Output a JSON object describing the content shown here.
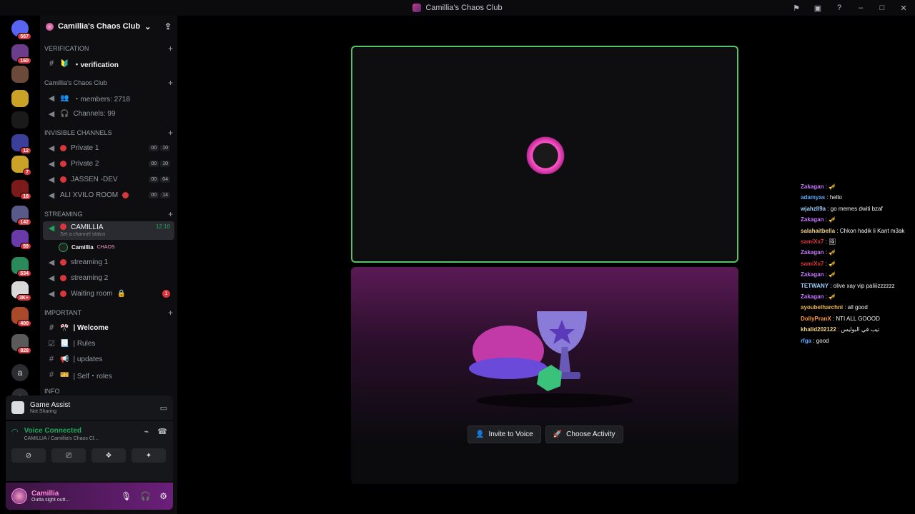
{
  "window": {
    "title": "Camillia's Chaos Club"
  },
  "guilds": [
    {
      "name": "home",
      "badge": "567",
      "color": "#5865f2"
    },
    {
      "name": "server-1",
      "badge": "160",
      "color": "#6b3d8a"
    },
    {
      "name": "server-2",
      "badge": "",
      "color": "#6b4a3a"
    },
    {
      "name": "server-3",
      "badge": "",
      "color": "#c9a227"
    },
    {
      "name": "server-4",
      "badge": "",
      "color": "#1a1a1a"
    },
    {
      "name": "server-5",
      "badge": "12",
      "color": "#3b3f9a"
    },
    {
      "name": "server-6",
      "badge": "7",
      "color": "#c9a227"
    },
    {
      "name": "server-7",
      "badge": "18",
      "color": "#7a1a1a"
    },
    {
      "name": "server-8",
      "badge": "142",
      "color": "#5a5a8a"
    },
    {
      "name": "server-9",
      "badge": "59",
      "color": "#6a3aa8"
    },
    {
      "name": "server-10",
      "badge": "534",
      "color": "#2a8a5a"
    },
    {
      "name": "server-11",
      "badge": "3K+",
      "color": "#d8d8d8"
    },
    {
      "name": "server-12",
      "badge": "400",
      "color": "#a84a2a"
    },
    {
      "name": "server-13",
      "badge": "828",
      "color": "#5a5a5a"
    },
    {
      "name": "server-14",
      "badge": "",
      "color": "#2b2d31",
      "letter": "a"
    },
    {
      "name": "add-server",
      "badge": "",
      "color": "#2b2d31",
      "letter": "+"
    }
  ],
  "server": {
    "name": "Camillia's Chaos Club"
  },
  "sidebar": {
    "cat_verification": "VERIFICATION",
    "ch_verification": "・verification",
    "cat_club": "Camillia's Chaos Club",
    "ch_members": "・members: 2718",
    "ch_channels": "Channels: 99",
    "cat_invisible": "INVISIBLE CHANNELS",
    "ch_private1": "Private 1",
    "ch_private2": "Private 2",
    "ch_jassen": "JASSEN -DEV",
    "ch_ali": "ALI XVILO ROOM",
    "lim_00": "00",
    "lim_10": "10",
    "lim_04": "04",
    "lim_14": "14",
    "cat_streaming": "STREAMING",
    "ch_camillia": "CAMILLIA",
    "ch_camillia_time": "12:10",
    "ch_camillia_status": "Set a channel status",
    "user_in": "Camillia",
    "user_tag": "CHAOS",
    "ch_stream1": "streaming 1",
    "ch_stream2": "streaming 2",
    "ch_waiting": "Waiting room",
    "waiting_badge": "1",
    "cat_important": "IMPORTANT",
    "ch_welcome": "| Welcome",
    "ch_rules": "| Rules",
    "ch_updates": "| updates",
    "ch_roles": "| Self・roles",
    "cat_info": "INFO"
  },
  "game_assist": {
    "title": "Game Assist",
    "sub": "Not Sharing"
  },
  "voice": {
    "title": "Voice Connected",
    "sub": "CAMILLIA / Camillia's Chaos Cl..."
  },
  "user_panel": {
    "name": "Camillia",
    "status": "Outta sight outt..."
  },
  "activity": {
    "invite": "Invite to Voice",
    "choose": "Choose Activity"
  },
  "chat": [
    {
      "user": "Zakagan",
      "text": ": 🎺",
      "color": "#c678ff"
    },
    {
      "user": "adamyas",
      "text": ": hello",
      "color": "#5aa8ff"
    },
    {
      "user": "wjahzll9a",
      "text": ": go memes dwiti bzaf",
      "color": "#9ad0ff"
    },
    {
      "user": "Zakagan",
      "text": ": 🎺",
      "color": "#c678ff"
    },
    {
      "user": "salahaitbella",
      "text": ": Chkon hadik li Kant m3ak",
      "color": "#f2d38a"
    },
    {
      "user": "samiXx7",
      "text": ": 🖼",
      "color": "#da373c"
    },
    {
      "user": "Zakagan",
      "text": ": 🎺",
      "color": "#c678ff"
    },
    {
      "user": "samiXx7",
      "text": ": 🎺",
      "color": "#da373c"
    },
    {
      "user": "Zakagan",
      "text": ": 🎺",
      "color": "#c678ff"
    },
    {
      "user": "TETWANY",
      "text": ": olive xay vip paliiizzzzzz",
      "color": "#9ad0ff"
    },
    {
      "user": "Zakagan",
      "text": ": 🎺",
      "color": "#c678ff"
    },
    {
      "user": "ayoubelharchni",
      "text": ": all good",
      "color": "#f2b84a"
    },
    {
      "user": "DollyPranX",
      "text": ": NTI ALL GOOOD",
      "color": "#ff9a3a"
    },
    {
      "user": "khalid202122",
      "text": ": تيب في البوليس",
      "color": "#f2d38a"
    },
    {
      "user": "rfga",
      "text": ": good",
      "color": "#5aa8ff"
    }
  ]
}
